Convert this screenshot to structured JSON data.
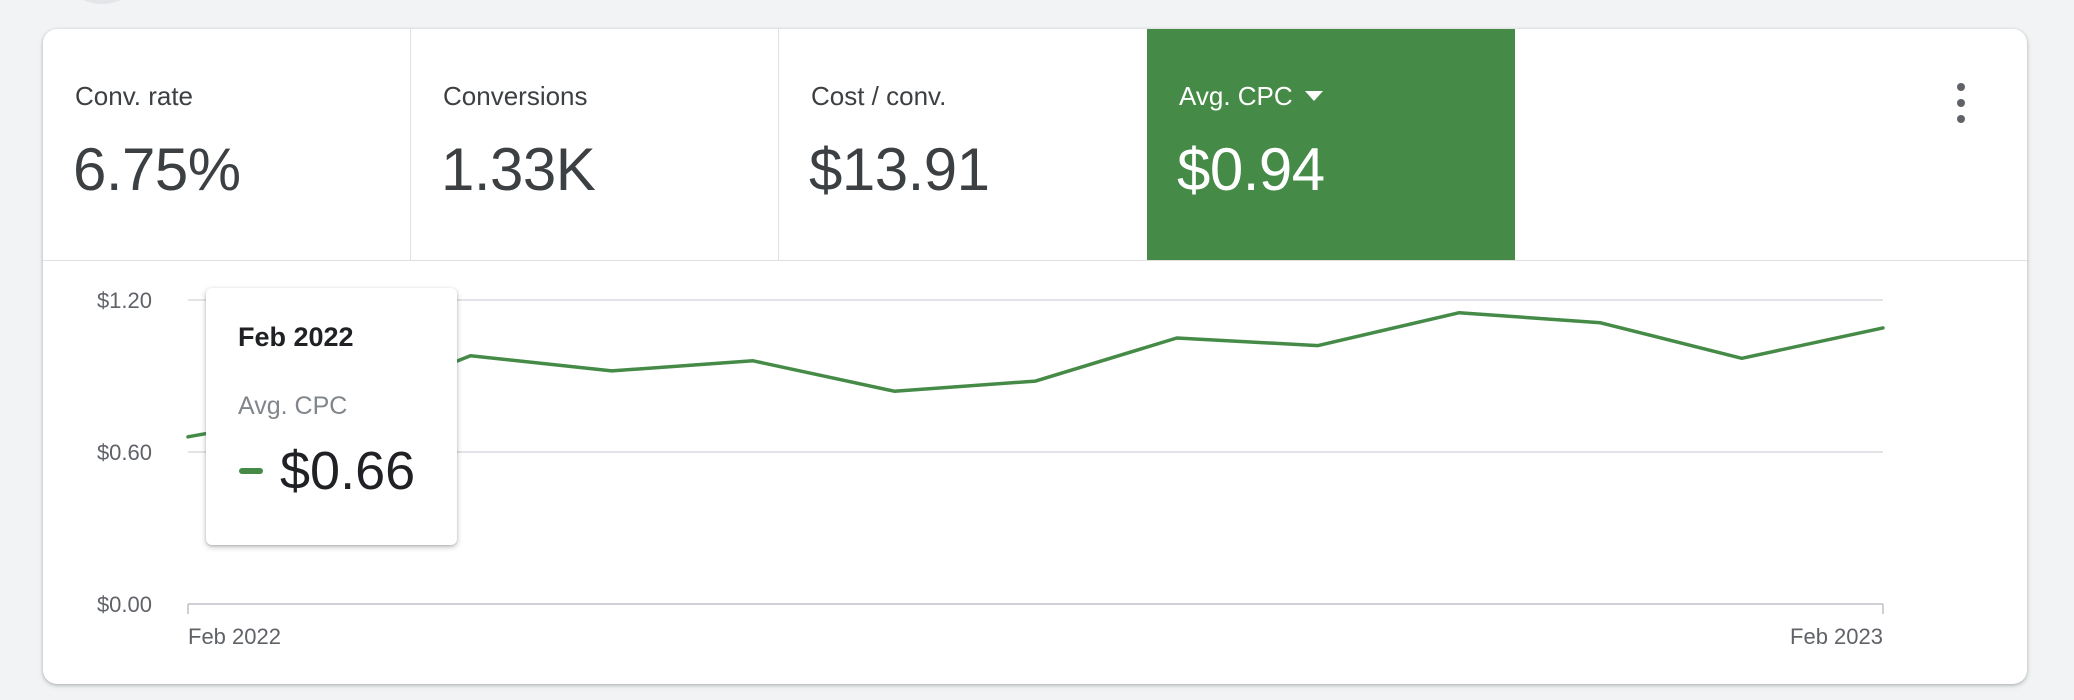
{
  "metrics": [
    {
      "label": "Conv. rate",
      "value": "6.75%"
    },
    {
      "label": "Conversions",
      "value": "1.33K"
    },
    {
      "label": "Cost / conv.",
      "value": "$13.91"
    },
    {
      "label": "Avg. CPC",
      "value": "$0.94",
      "selected": true
    }
  ],
  "icons": {
    "more": "more-vert-icon",
    "dropdown": "caret-down-icon",
    "swatch": "series-swatch"
  },
  "colors": {
    "accent": "#458b47",
    "card": "#ffffff",
    "background": "#f1f3f4",
    "text": "#3c4043",
    "grid": "#dadce0"
  },
  "tooltip": {
    "date": "Feb 2022",
    "metric": "Avg. CPC",
    "value": "$0.66"
  },
  "chart_data": {
    "type": "line",
    "series": [
      {
        "values": [
          0.66,
          0.76,
          0.98,
          0.92,
          0.96,
          0.84,
          0.88,
          1.05,
          1.02,
          1.15,
          1.11,
          0.97,
          1.09
        ]
      }
    ],
    "x_tick_labels": [
      "Feb 2022",
      "Feb 2023"
    ],
    "y_tick_labels": [
      "$0.00",
      "$0.60",
      "$1.20"
    ],
    "y_ticks": [
      0,
      0.6,
      1.2
    ],
    "ylim": [
      0,
      1.2
    ],
    "grid": true,
    "legend": "none"
  }
}
